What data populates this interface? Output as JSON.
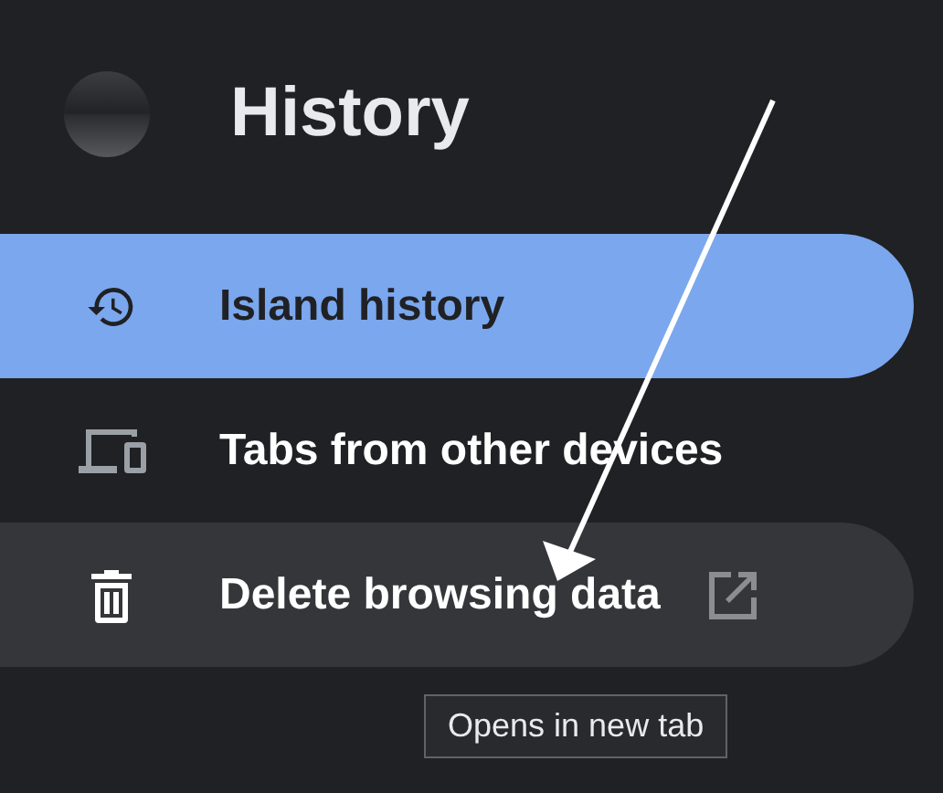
{
  "header": {
    "title": "History"
  },
  "nav_items": [
    {
      "label": "Island history",
      "selected": true,
      "hovered": false,
      "external": false
    },
    {
      "label": "Tabs from other devices",
      "selected": false,
      "hovered": false,
      "external": false
    },
    {
      "label": "Delete browsing data",
      "selected": false,
      "hovered": true,
      "external": true
    }
  ],
  "tooltip": {
    "text": "Opens in new tab"
  }
}
